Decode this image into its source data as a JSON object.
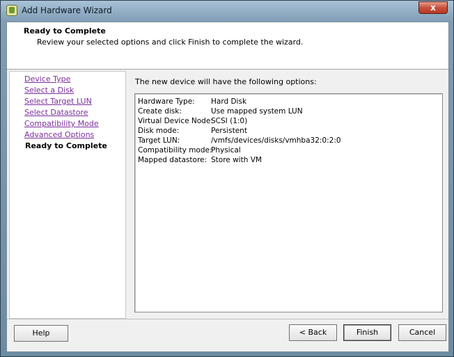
{
  "window": {
    "title": "Add Hardware Wizard",
    "close_label": "x"
  },
  "header": {
    "title": "Ready to Complete",
    "description": "Review your selected options and click Finish to complete the wizard."
  },
  "nav": {
    "items": [
      {
        "label": "Device Type"
      },
      {
        "label": "Select a Disk"
      },
      {
        "label": "Select Target LUN"
      },
      {
        "label": "Select Datastore"
      },
      {
        "label": "Compatibility Mode"
      },
      {
        "label": "Advanced Options"
      },
      {
        "label": "Ready to Complete"
      }
    ],
    "current_index": 6
  },
  "main": {
    "intro": "The new device will have the following options:",
    "options": [
      {
        "key": "Hardware Type:",
        "value": "Hard Disk"
      },
      {
        "key": "Create disk:",
        "value": "Use mapped system LUN"
      },
      {
        "key": "Virtual Device Node:",
        "value": "SCSI (1:0)"
      },
      {
        "key": "Disk mode:",
        "value": "Persistent"
      },
      {
        "key": "Target LUN:",
        "value": "/vmfs/devices/disks/vmhba32:0:2:0"
      },
      {
        "key": "Compatibility mode:",
        "value": "Physical"
      },
      {
        "key": "Mapped datastore:",
        "value": "Store with VM"
      }
    ]
  },
  "buttons": {
    "help": "Help",
    "back": "< Back",
    "finish": "Finish",
    "cancel": "Cancel"
  },
  "colors": {
    "link": "#7b2e9b",
    "header_bg": "#ffffff",
    "dialog_bg": "#f0f0f0"
  }
}
